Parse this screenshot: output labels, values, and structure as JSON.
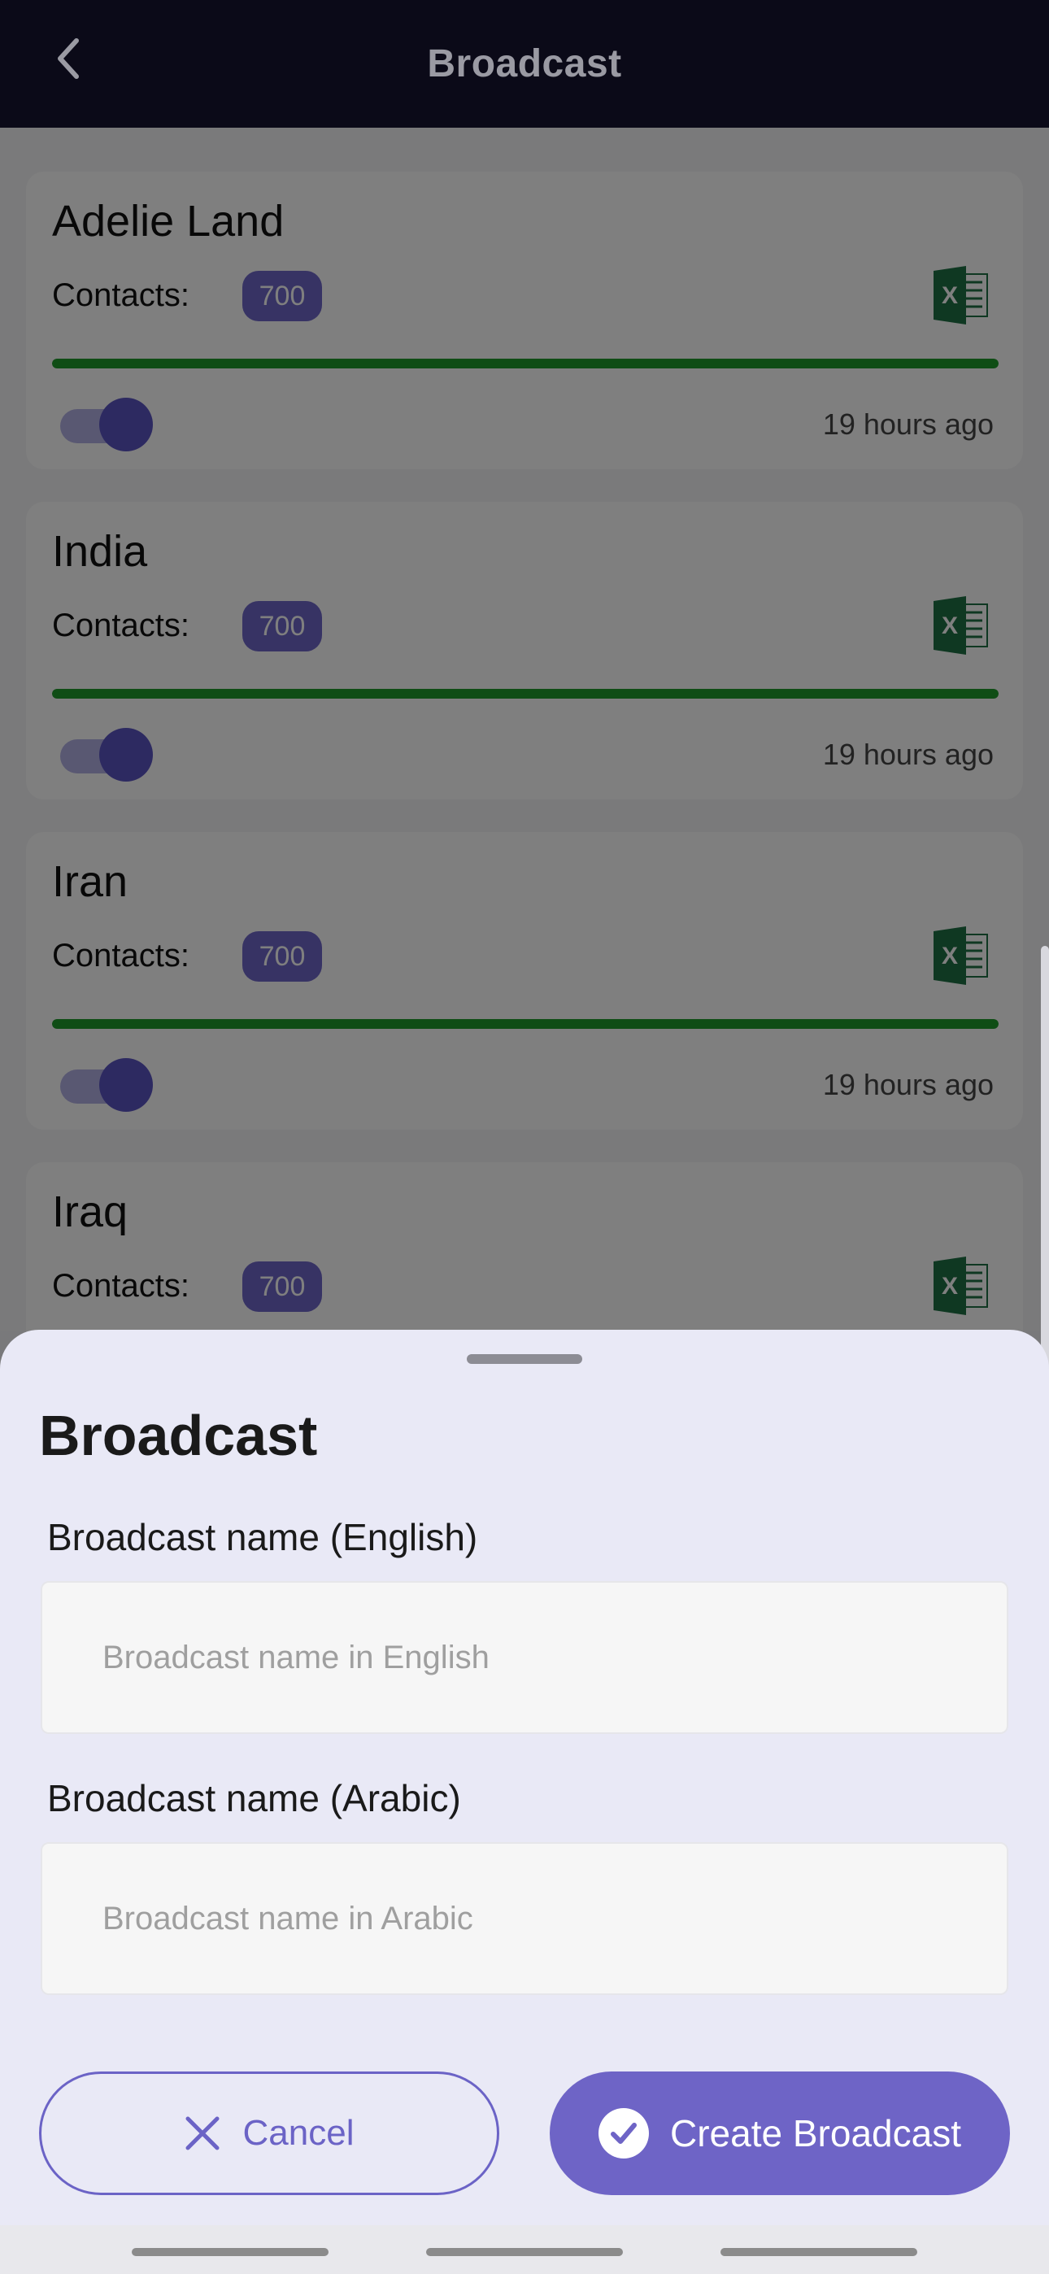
{
  "header": {
    "title": "Broadcast"
  },
  "cards": [
    {
      "name": "Adelie Land",
      "contacts_label": "Contacts:",
      "contacts_count": "700",
      "progress": 1.0,
      "toggle_on": true,
      "time": "19 hours ago"
    },
    {
      "name": "India",
      "contacts_label": "Contacts:",
      "contacts_count": "700",
      "progress": 1.0,
      "toggle_on": true,
      "time": "19 hours ago"
    },
    {
      "name": "Iran",
      "contacts_label": "Contacts:",
      "contacts_count": "700",
      "progress": 1.0,
      "toggle_on": true,
      "time": "19 hours ago"
    },
    {
      "name": "Iraq",
      "contacts_label": "Contacts:",
      "contacts_count": "700"
    }
  ],
  "sheet": {
    "title": "Broadcast",
    "english_label": "Broadcast name (English)",
    "english_placeholder": "Broadcast name in English",
    "arabic_label": "Broadcast name (Arabic)",
    "arabic_placeholder": "Broadcast name in Arabic",
    "cancel_label": "Cancel",
    "create_label": "Create Broadcast"
  },
  "colors": {
    "accent": "#6e64c6",
    "progress": "#1f9a2b",
    "excel_green": "#1e7145",
    "header_bg": "#0b0a18"
  },
  "icons": {
    "back": "chevron-left-icon",
    "excel": "excel-icon",
    "cancel": "close-icon",
    "create": "check-circle-icon"
  }
}
